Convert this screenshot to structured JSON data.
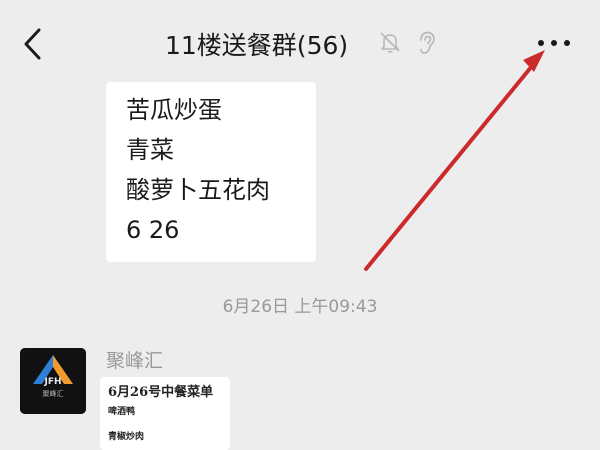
{
  "header": {
    "title": "11楼送餐群(56)",
    "back_icon": "chevron-left-icon",
    "mute_icon": "bell-off-icon",
    "ear_icon": "ear-icon",
    "more_icon": "more-dots-icon"
  },
  "messages": {
    "first": {
      "lines": [
        "苦瓜炒蛋",
        "青菜",
        "酸萝卜五花肉",
        "6 26"
      ]
    },
    "timestamp": "6月26日 上午09:43",
    "second": {
      "sender": "聚峰汇",
      "avatar_logo_text": "JFH",
      "avatar_caption": "聚峰汇",
      "card": {
        "title": "6月26号中餐菜单",
        "items": [
          "啤酒鸭",
          "青椒炒肉"
        ]
      }
    }
  },
  "colors": {
    "background": "#ededed",
    "bubble": "#ffffff",
    "annotation_arrow": "#cc2a2a",
    "logo_blue": "#2f7fd8",
    "logo_orange": "#f29a2e"
  }
}
